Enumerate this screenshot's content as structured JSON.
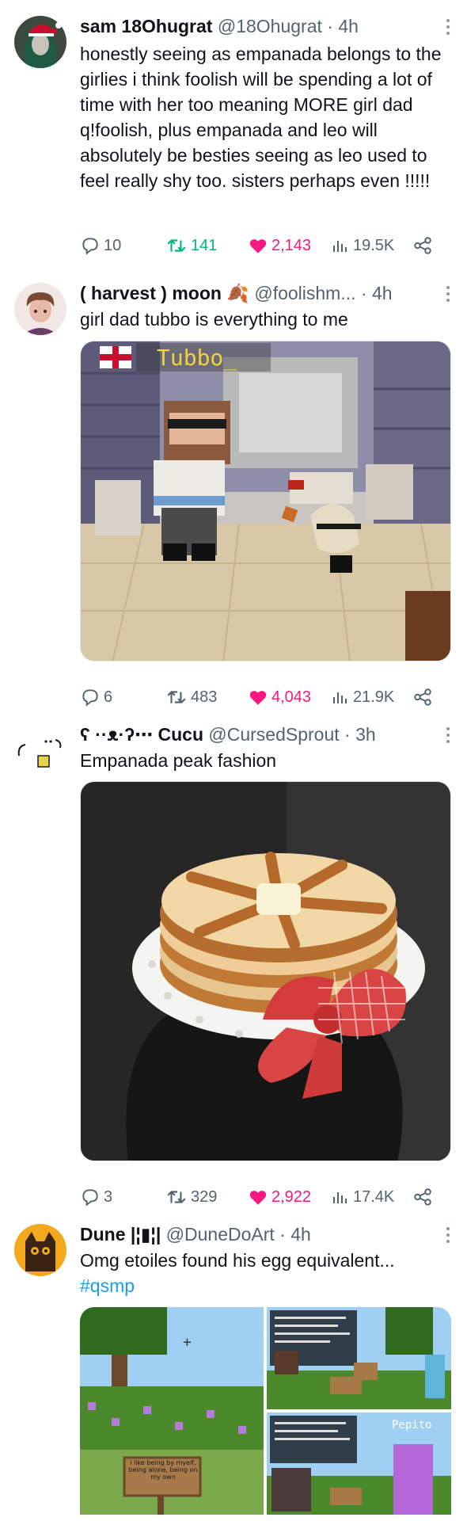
{
  "tweets": [
    {
      "name": "sam 18Ohugrat",
      "handle": "@18Ohugrat",
      "time": "· 4h",
      "text": "honestly seeing as empanada belongs to the girlies i think foolish will be spending a lot of time with her too meaning MORE girl dad q!foolish, plus empanada and leo will absolutely be besties seeing as leo used to feel really shy too. sisters perhaps even !!!!!",
      "replies": "10",
      "retweets": "141",
      "likes": "2,143",
      "views": "19.5K",
      "retweet_active": true
    },
    {
      "name": "( harvest ) moon",
      "handle": "@foolishm...",
      "time": "· 4h",
      "text": "girl dad tubbo is everything to me",
      "media_label": "Tubbo_",
      "replies": "6",
      "retweets": "483",
      "likes": "4,043",
      "views": "21.9K",
      "retweet_active": false
    },
    {
      "name": "ʕ ··ᴥ·ʔ⋯ Cucu",
      "handle": "@CursedSprout",
      "time": "· 3h",
      "text": "Empanada peak fashion",
      "replies": "3",
      "retweets": "329",
      "likes": "2,922",
      "views": "17.4K",
      "retweet_active": false
    },
    {
      "name": "Dune |¦▮¦|",
      "handle": "@DuneDoArt",
      "time": "· 4h",
      "text": "Omg etoiles found his egg equivalent...",
      "hashtag": "#qsmp",
      "sign_text": "i like being by myelf, being alone, being on my own",
      "stream_label": "Pepito"
    }
  ],
  "colors": {
    "retweet": "#00ba7c",
    "like": "#f91880",
    "meta": "#536471",
    "link": "#1d9bf0"
  },
  "icons": [
    "reply-icon",
    "retweet-icon",
    "heart-icon",
    "views-icon",
    "share-icon",
    "more-icon"
  ]
}
